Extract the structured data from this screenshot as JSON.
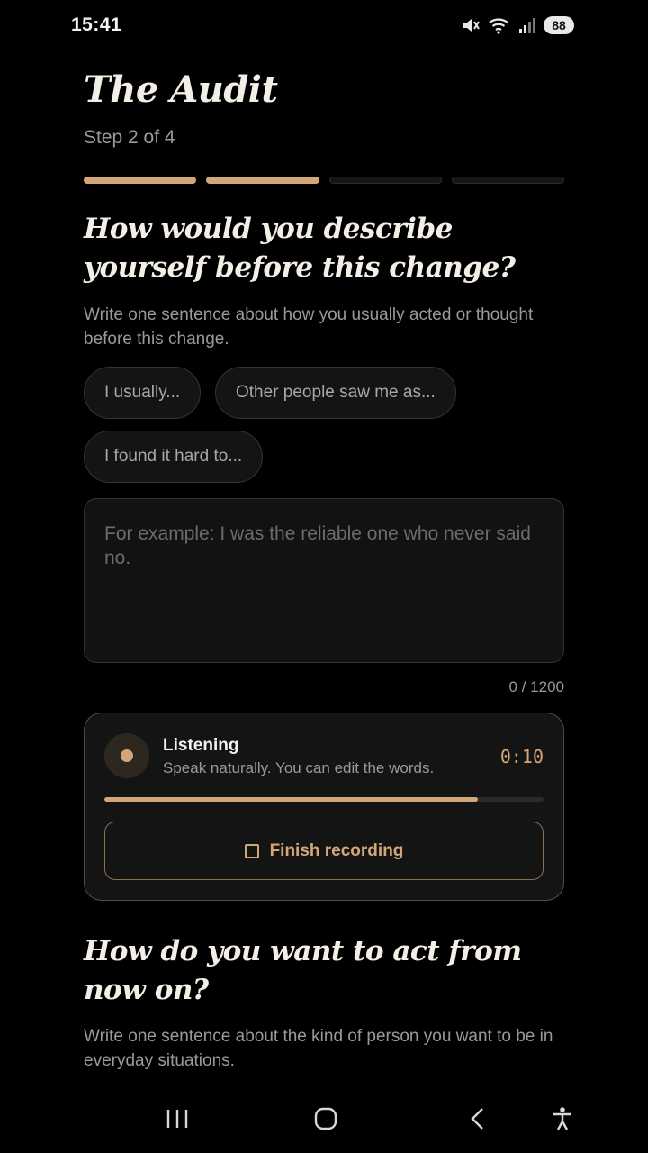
{
  "status_bar": {
    "time": "15:41",
    "battery": "88"
  },
  "header": {
    "title": "The Audit",
    "step": "Step 2 of 4"
  },
  "progress": {
    "total_steps": 4,
    "completed_steps": 2
  },
  "question1": {
    "title": "How would you describe yourself before this change?",
    "helper": "Write one sentence about how you usually acted or thought before this change.",
    "chips": [
      "I usually...",
      "Other people saw me as...",
      "I found it hard to..."
    ],
    "placeholder": "For example: I was the reliable one who never said no.",
    "char_count": "0 / 1200"
  },
  "recording": {
    "title": "Listening",
    "subtitle": "Speak naturally. You can edit the words.",
    "timer": "0:10",
    "progress_fraction": 0.85,
    "finish_label": "Finish recording"
  },
  "question2": {
    "title": "How do you want to act from now on?",
    "helper": "Write one sentence about the kind of person you want to be in everyday situations."
  },
  "colors": {
    "accent": "#d2a679",
    "background": "#000000",
    "surface": "#141414"
  },
  "nav": {
    "icons": [
      "recent-apps-icon",
      "home-icon",
      "back-icon",
      "accessibility-icon"
    ]
  }
}
